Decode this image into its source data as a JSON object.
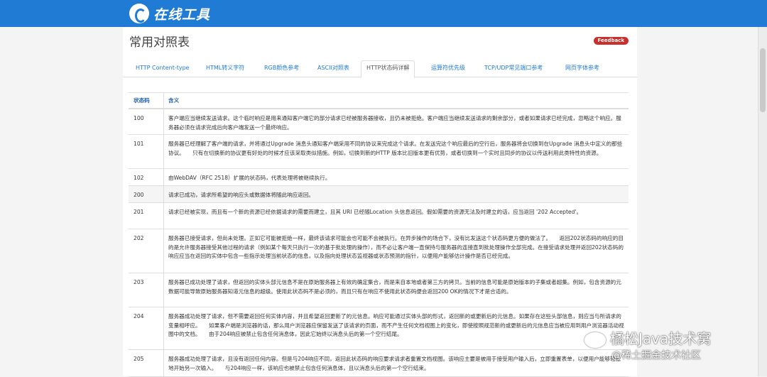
{
  "header": {
    "logo_text": "在线工具"
  },
  "page": {
    "title": "常用对照表",
    "feedback_label": "Feedback"
  },
  "tabs": [
    {
      "label": "HTTP Content-type"
    },
    {
      "label": "HTML转义字符"
    },
    {
      "label": "RGB颜色参考"
    },
    {
      "label": "ASCII对照表"
    },
    {
      "label": "HTTP状态码详解",
      "active": true
    },
    {
      "label": "运算符优先级"
    },
    {
      "label": "TCP/UDP常见端口参考"
    },
    {
      "label": "网页字体参考"
    }
  ],
  "table": {
    "headers": {
      "code": "状态码",
      "meaning": "含义"
    },
    "rows": [
      {
        "code": "100",
        "meaning": "客户端应当继续发送请求。这个临时响应是用来通知客户端它的部分请求已经被服务器接收，且仍未被拒绝。客户端应当继续发送请求的剩余部分，或者如果请求已经完成，忽略这个响应。服务器必须在请求完成后向客户端发送一个最终响应。"
      },
      {
        "code": "101",
        "meaning": "服务器已经理解了客户端的请求，并将通过Upgrade 消息头通知客户端采用不同的协议来完成这个请求。在发送完这个响应最后的空行后，服务器将会切换到在Upgrade 消息头中定义的那些协议。　　只有在切换新的协议更有好处的时候才应该采取类似措施。例如，切换到新的HTTP 版本比旧版本更有优势，或者切换到一个实时且同步的协议以传送利用此类特性的资源。"
      },
      {
        "code": "102",
        "meaning": "由WebDAV（RFC 2518）扩展的状态码，代表处理将被继续执行。"
      },
      {
        "code": "200",
        "meaning": "请求已成功，请求所希望的响应头或数据体将随此响应返回。"
      },
      {
        "code": "201",
        "meaning": "请求已经被实现，而且有一个新的资源已经依据请求的需要而建立，且其 URI 已经随Location 头信息返回。假如需要的资源无法及时建立的话，应当返回 '202 Accepted'。"
      },
      {
        "code": "202",
        "meaning": "服务器已接受请求，但尚未处理。正如它可能被拒绝一样，最终该请求可能会也可能不会被执行。在异步操作的场合下，没有比发送这个状态码更方便的做法了。　　返回202状态码的响应的目的是允许服务器接受其他过程的请求（例如某个每天只执行一次的基于批处理的操作），而不必让客户端一直保持与服务器的连接直到批处理操作全部完成。在接受请求处理并返回202状态码的响应应当在返回的实体中包含一些指示处理当前状态的信息，以及指向处理状态监视器或状态预测的指针，以便用户能够估计操作是否已经完成。"
      },
      {
        "code": "203",
        "meaning": "服务器已成功处理了请求，但返回的实体头部元信息不是在原始服务器上有效的确定集合，而是来自本地或者第三方的拷贝。当前的信息可能是原始版本的子集或者超集。例如，包含资源的元数据可能导致原始服务器知道元信息的超级。使用此状态码不是必须的，而且只有在响应不使用此状态码便会返回200 OK的情况下才是合适的。"
      },
      {
        "code": "204",
        "meaning": "服务器成功处理了请求，但不需要返回任何实体内容，并且希望返回更新了的元信息。响应可能通过实体头部的形式，返回新的或更新后的元信息。如果存在这些头部信息，则应当与所请求的变量相呼应。　　如果客户端是浏览器的话，那么用户浏览器应保留发送了该请求的页面，而不产生任何文档视图上的变化，即使按照规范新的或更新后的元信息应当被应用到用户浏览器活动视图中的文档。　　由于204响应被禁止包含任何消息体，因此它始终以消息头后的第一个空行结尾。"
      },
      {
        "code": "205",
        "meaning": "服务器成功处理了请求，且没有返回任何内容。但是与204响应不同，返回此状态码的响应要求请求者重置文档视图。该响应主要是被用于接受用户输入后，立即重置表单，以便用户能够轻松地开始另一次输入。　　与204响应一样，该响应也被禁止包含任何消息体，且以消息头后的第一个空行结束。"
      }
    ]
  },
  "watermark": {
    "line1": "橘松Java技术窝",
    "line2": "@稀土掘金技术社区"
  }
}
